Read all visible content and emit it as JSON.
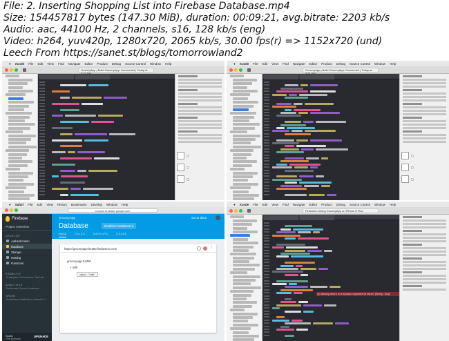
{
  "header": {
    "lines": [
      "File: 2. Inserting Shopping List into Firebase Database.mp4",
      "Size: 154457817 bytes (147.30 MiB), duration: 00:09:21, avg.bitrate: 2203 kb/s",
      "Audio: aac, 44100 Hz, 2 channels, s16, 128 kb/s (eng)",
      "Video: h264, yuv420p, 1280x720, 2065 kb/s, 30.00 fps(r) => 1152x720 (und)",
      "Leech From https://sanet.st/blogs/tomorrowland2"
    ]
  },
  "thumbs": [
    {
      "app": "Xcode",
      "menus": [
        "File",
        "Edit",
        "View",
        "Find",
        "Navigate",
        "Editor",
        "Product",
        "Debug",
        "Source Control",
        "Window",
        "Help"
      ],
      "status": "GroceryApp | Build GroceryApp: Succeeded | Today at 3:31 PM",
      "colors": {
        "traffic_red": "#ff5f57",
        "traffic_yellow": "#febc2e",
        "traffic_green": "#28c840"
      }
    },
    {
      "app": "Xcode",
      "menus": [
        "File",
        "Edit",
        "View",
        "Find",
        "Navigate",
        "Editor",
        "Product",
        "Debug",
        "Source Control",
        "Window",
        "Help"
      ],
      "status": "GroceryApp | Build GroceryApp: Succeeded | Today at 3:31 PM"
    },
    {
      "app": "Safari",
      "menus": [
        "File",
        "Edit",
        "View",
        "History",
        "Bookmarks",
        "Develop",
        "Window",
        "Help"
      ],
      "url": "console.firebase.google.com",
      "firebase": {
        "brand": "Firebase",
        "project": "Project Overview",
        "project_top": "GroceryApp",
        "section_develop": "DEVELOP",
        "items": [
          "Authentication",
          "Database",
          "Storage",
          "Hosting",
          "Functions"
        ],
        "section_stability": "STABILITY",
        "stability_sub": "Crashlytics, Performance, Test Lab...",
        "section_analytics": "ANALYTICS",
        "analytics_sub": "Dashboard, Events, Audiences...",
        "section_grow": "GROW",
        "grow_sub": "Predictions, Notifications, Remote C...",
        "plan": "Spark",
        "plan_sub": "Free $0/month",
        "upgrade": "UPGRADE",
        "title": "Database",
        "db_type": "Realtime Database",
        "goto_docs": "Go to docs",
        "tabs": [
          "DATA",
          "RULES",
          "BACKUPS",
          "USAGE"
        ],
        "db_url": "https://groceryapp-b4350.firebaseio.com/",
        "root_node": "groceryapp-b4350",
        "child_node": "+ milk",
        "kv": "value : \"milk\""
      }
    },
    {
      "app": "Xcode",
      "menus": [
        "File",
        "Edit",
        "View",
        "Find",
        "Navigate",
        "Editor",
        "Product",
        "Debug",
        "Source Control",
        "Window",
        "Help"
      ],
      "status": "Finished running GroceryApp on iPhone 8 Plus",
      "error": "Missing return in a function expected to return '[String : Any]'"
    }
  ]
}
